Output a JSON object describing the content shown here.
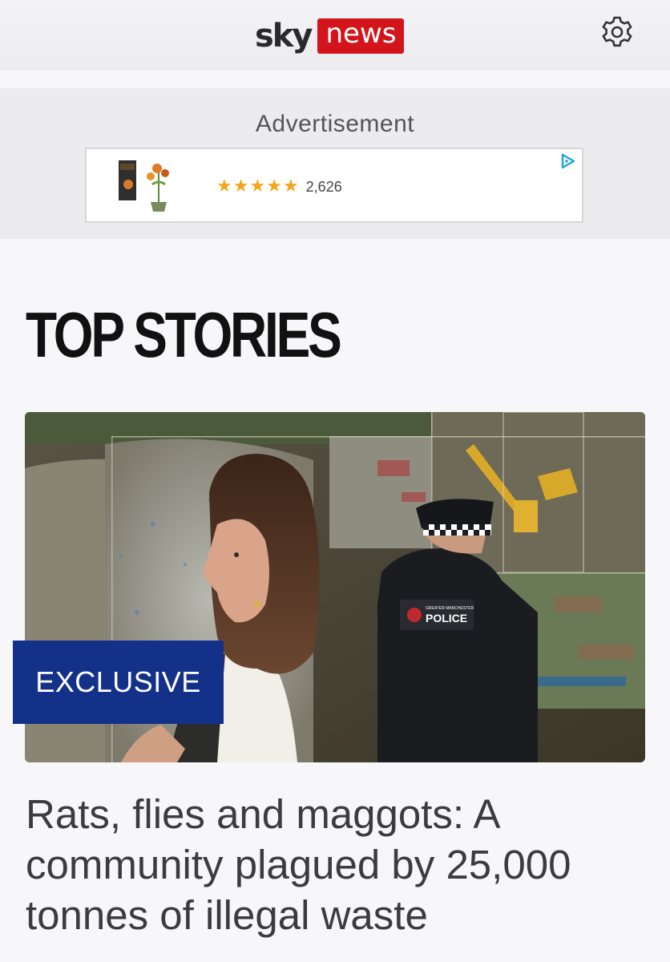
{
  "header": {
    "logo_sky": "sky",
    "logo_news": "news",
    "settings_icon": "gear-icon",
    "brand_color": "#d4141b"
  },
  "advertisement": {
    "label": "Advertisement",
    "rating_stars": 5,
    "review_count": "2,626",
    "star_color": "#f2a71b",
    "choice_icon": "adchoices-icon"
  },
  "section": {
    "title": "TOP STORIES"
  },
  "story": {
    "badge": "EXCLUSIVE",
    "badge_color": "#14318a",
    "police_patch": "POLICE",
    "police_patch_small": "GREATER MANCHESTER",
    "headline": "Rats, flies and maggots: A community plagued by 25,000 tonnes of illegal waste"
  }
}
